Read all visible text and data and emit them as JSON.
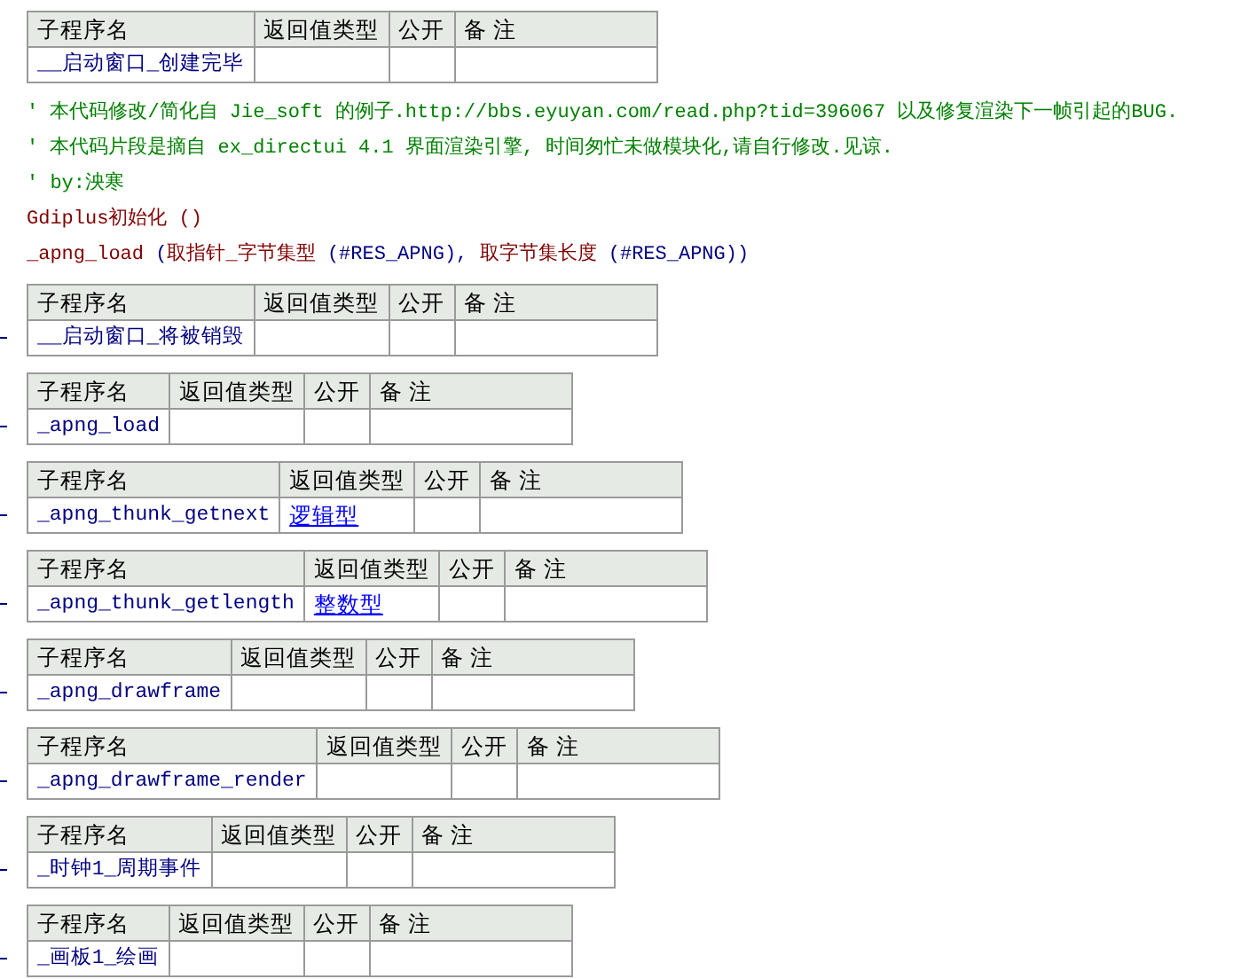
{
  "blocks": [
    {
      "kind": "table",
      "row_marker": false,
      "headers": [
        "子程序名",
        "返回值类型",
        "公开",
        "备 注"
      ],
      "name": "__启动窗口_创建完毕"
    },
    {
      "kind": "comment",
      "text": "' 本代码修改/简化自 Jie_soft 的例子.http://bbs.eyuyan.com/read.php?tid=396067 以及修复渲染下一帧引起的BUG."
    },
    {
      "kind": "comment",
      "text": "' 本代码片段是摘自 ex_directui 4.1 界面渲染引擎, 时间匆忙未做模块化,请自行修改.见谅."
    },
    {
      "kind": "comment",
      "text": "' by:泱寒"
    },
    {
      "kind": "code",
      "segments": [
        {
          "kind": "call",
          "text": "Gdiplus初始化 ()"
        }
      ]
    },
    {
      "kind": "code",
      "segments": [
        {
          "kind": "call",
          "text": "_apng_load "
        },
        {
          "kind": "arg",
          "text": "("
        },
        {
          "kind": "call",
          "text": "取指针_字节集型 "
        },
        {
          "kind": "arg",
          "text": "(#RES_APNG), "
        },
        {
          "kind": "call",
          "text": "取字节集长度 "
        },
        {
          "kind": "arg",
          "text": "(#RES_APNG))"
        }
      ]
    },
    {
      "kind": "table",
      "row_marker": true,
      "headers": [
        "子程序名",
        "返回值类型",
        "公开",
        "备 注"
      ],
      "name": "__启动窗口_将被销毁"
    },
    {
      "kind": "table",
      "row_marker": true,
      "headers": [
        "子程序名",
        "返回值类型",
        "公开",
        "备 注"
      ],
      "name": "_apng_load"
    },
    {
      "kind": "table",
      "row_marker": true,
      "headers": [
        "子程序名",
        "返回值类型",
        "公开",
        "备 注"
      ],
      "name": "_apng_thunk_getnext",
      "return_type": "逻辑型"
    },
    {
      "kind": "table",
      "row_marker": true,
      "headers": [
        "子程序名",
        "返回值类型",
        "公开",
        "备 注"
      ],
      "name": "_apng_thunk_getlength",
      "return_type": "整数型"
    },
    {
      "kind": "table",
      "row_marker": true,
      "headers": [
        "子程序名",
        "返回值类型",
        "公开",
        "备 注"
      ],
      "name": "_apng_drawframe"
    },
    {
      "kind": "table",
      "row_marker": true,
      "headers": [
        "子程序名",
        "返回值类型",
        "公开",
        "备 注"
      ],
      "name": "_apng_drawframe_render"
    },
    {
      "kind": "table",
      "row_marker": true,
      "headers": [
        "子程序名",
        "返回值类型",
        "公开",
        "备 注"
      ],
      "name": "_时钟1_周期事件"
    },
    {
      "kind": "table",
      "row_marker": true,
      "headers": [
        "子程序名",
        "返回值类型",
        "公开",
        "备 注"
      ],
      "name": "_画板1_绘画"
    }
  ]
}
